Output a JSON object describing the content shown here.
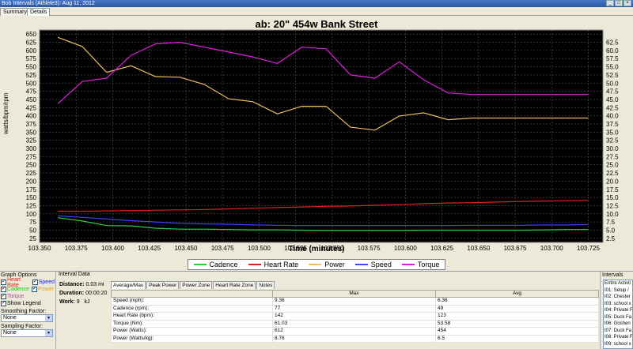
{
  "window": {
    "title": "Bob Intervals (Athlete3): Aug 11, 2012",
    "buttons": [
      "_",
      "□",
      "×"
    ]
  },
  "tabs": [
    "Summary",
    "Details"
  ],
  "chart_data": {
    "type": "line",
    "title": "ab:  20\" 454w Bank Street",
    "xlabel": "Time (minutes)",
    "ylabel": "watts/bpm/rpm",
    "xlim": [
      103.35,
      103.735
    ],
    "x_ticks": [
      "103.350",
      "103.375",
      "103.400",
      "103.425",
      "103.450",
      "103.475",
      "103.500",
      "103.525",
      "103.550",
      "103.575",
      "103.600",
      "103.625",
      "103.650",
      "103.675",
      "103.700",
      "103.725"
    ],
    "ylim_left": [
      12.5,
      662.5
    ],
    "y_ticks_left": [
      "25",
      "50",
      "75",
      "100",
      "125",
      "150",
      "175",
      "200",
      "225",
      "250",
      "275",
      "300",
      "325",
      "350",
      "375",
      "400",
      "425",
      "450",
      "475",
      "500",
      "525",
      "550",
      "575",
      "600",
      "625",
      "650"
    ],
    "ylim_right": [
      1.25,
      66.25
    ],
    "y_ticks_right": [
      "2.5",
      "5.0",
      "7.5",
      "10.0",
      "12.5",
      "15.0",
      "17.5",
      "20.0",
      "22.5",
      "25.0",
      "27.5",
      "30.0",
      "32.5",
      "35.0",
      "37.5",
      "40.0",
      "42.5",
      "45.0",
      "47.5",
      "50.0",
      "52.5",
      "55.0",
      "57.5",
      "60.0",
      "62.5"
    ],
    "grid": true,
    "x": [
      103.3625,
      103.3792,
      103.3958,
      103.4125,
      103.4292,
      103.4458,
      103.4625,
      103.4792,
      103.4958,
      103.5125,
      103.5292,
      103.5458,
      103.5625,
      103.5792,
      103.5958,
      103.6125,
      103.6292,
      103.6458,
      103.6625,
      103.6792,
      103.6958,
      103.7125,
      103.725
    ],
    "series": [
      {
        "name": "Cadence",
        "axis": "left",
        "color": "#2ecc40",
        "values": [
          88,
          78,
          64,
          63,
          56,
          53,
          53,
          52,
          51,
          51,
          50,
          49,
          49,
          49,
          49,
          50,
          50,
          50,
          50,
          50,
          51,
          52,
          52
        ]
      },
      {
        "name": "Heart Rate",
        "axis": "left",
        "color": "#e02020",
        "values": [
          108,
          108,
          109,
          110,
          111,
          112,
          113,
          115,
          117,
          119,
          121,
          123,
          124,
          126,
          128,
          131,
          133,
          134,
          136,
          138,
          139,
          140,
          141
        ]
      },
      {
        "name": "Power",
        "axis": "left",
        "color": "#e8c060",
        "values": [
          640,
          612,
          533,
          553,
          520,
          518,
          496,
          452,
          443,
          406,
          429,
          429,
          365,
          356,
          399,
          409,
          388,
          393,
          393,
          393,
          393,
          393,
          393
        ]
      },
      {
        "name": "Speed",
        "axis": "right",
        "color": "#4040ff",
        "values": [
          9.36,
          8.9,
          8.4,
          7.9,
          7.5,
          7.1,
          6.9,
          6.8,
          6.6,
          6.5,
          6.4,
          6.4,
          6.4,
          6.4,
          6.4,
          6.4,
          6.4,
          6.5,
          6.5,
          6.5,
          6.6,
          6.6,
          6.7
        ]
      },
      {
        "name": "Torque",
        "axis": "right",
        "color": "#e020e0",
        "values": [
          43.7,
          50.5,
          51.5,
          58.5,
          62.0,
          62.5,
          61.0,
          59.5,
          58.0,
          56.0,
          61.0,
          60.5,
          52.5,
          51.5,
          56.5,
          51.0,
          47.0,
          46.5,
          46.5,
          46.5,
          46.5,
          46.5,
          46.5
        ]
      }
    ]
  },
  "legend": [
    "Cadence",
    "Heart Rate",
    "Power",
    "Speed",
    "Torque"
  ],
  "graph_options": {
    "title": "Graph Options",
    "checks": [
      {
        "label": "Heart Rate",
        "color": "#e02020",
        "checked": true
      },
      {
        "label": "Speed",
        "color": "#2020e0",
        "checked": true
      },
      {
        "label": "Cadence",
        "color": "#20c020",
        "checked": true
      },
      {
        "label": "Power",
        "color": "#e0a020",
        "checked": true
      },
      {
        "label": "Torque",
        "color": "#e020e0",
        "checked": true
      }
    ],
    "show_legend": "Show Legend",
    "smoothing_label": "Smoothing Factor:",
    "smoothing_value": "None",
    "sampling_label": "Sampling Factor:",
    "sampling_value": "None"
  },
  "interval_data": {
    "title": "Interval Data",
    "distance_label": "Distance:",
    "distance_value": "0.03 mi",
    "duration_label": "Duration:",
    "duration_value": "00:00:20",
    "work_label": "Work:",
    "work_value": "9   kJ",
    "sub_tabs": [
      "Average/Max",
      "Peak Power",
      "Power Zone",
      "Heart Rate Zone",
      "Notes"
    ],
    "table_headers": [
      "",
      "Max",
      "Avg"
    ],
    "table_rows": [
      [
        "Speed (mph):",
        "9.36",
        "6.36"
      ],
      [
        "Cadence (rpm):",
        "77",
        "49"
      ],
      [
        "Heart Rate (bpm):",
        "142",
        "123"
      ],
      [
        "Torque (Nm):",
        "61.03",
        "53.58"
      ],
      [
        "Power (Watts):",
        "612",
        "454"
      ],
      [
        "Power (Watts/kg):",
        "8.76",
        "6.5"
      ]
    ]
  },
  "intervals": {
    "title": "Intervals",
    "items": [
      "Entire Activit",
      "I01: Setup /",
      "I02: Chester",
      "I03: school x",
      "I04: Private F",
      "I05: Duck Fa",
      "I06: Goshen",
      "I07: Duck Fa",
      "I08: Private F",
      "I09: school x"
    ]
  }
}
